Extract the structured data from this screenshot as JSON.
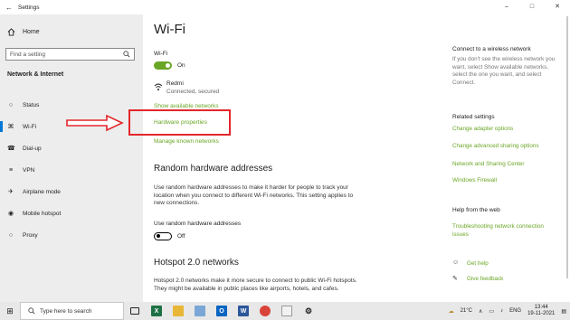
{
  "window": {
    "title": "Settings",
    "back_glyph": "←",
    "controls": [
      "–",
      "□",
      "✕"
    ]
  },
  "sidebar": {
    "home": "Home",
    "search_placeholder": "Find a setting",
    "section": "Network & Internet",
    "items": [
      {
        "label": "Status",
        "icon": "globe-icon"
      },
      {
        "label": "Wi-Fi",
        "icon": "wifi-icon"
      },
      {
        "label": "Dial-up",
        "icon": "phone-icon"
      },
      {
        "label": "VPN",
        "icon": "vpn-icon"
      },
      {
        "label": "Airplane mode",
        "icon": "airplane-icon"
      },
      {
        "label": "Mobile hotspot",
        "icon": "hotspot-icon"
      },
      {
        "label": "Proxy",
        "icon": "globe-icon"
      }
    ]
  },
  "main": {
    "title": "Wi-Fi",
    "wifi_label": "Wi-Fi",
    "wifi_state": "On",
    "network_name": "Redmi",
    "network_status": "Connected, secured",
    "show_networks": "Show available networks",
    "hardware_properties": "Hardware properties",
    "manage_networks": "Manage known networks",
    "random_title": "Random hardware addresses",
    "random_desc": "Use random hardware addresses to make it harder for people to track your location when you connect to different Wi-Fi networks. This setting applies to new connections.",
    "random_label": "Use random hardware addresses",
    "random_state": "Off",
    "hotspot_title": "Hotspot 2.0 networks",
    "hotspot_desc": "Hotspot 2.0 networks make it more secure to connect to public Wi-Fi hotspots. They might be available in public places like airports, hotels, and cafes."
  },
  "right_panel": {
    "connect_title": "Connect to a wireless network",
    "connect_desc": "If you don't see the wireless network you want, select Show available networks, select the one you want, and select Connect.",
    "related_title": "Related settings",
    "related_links": [
      "Change adapter options",
      "Change advanced sharing options",
      "Network and Sharing Center",
      "Windows Firewall"
    ],
    "help_title": "Help from the web",
    "help_link": "Troubleshooting network connection issues",
    "get_help": "Get help",
    "give_feedback": "Give feedback"
  },
  "taskbar": {
    "search_placeholder": "Type here to search",
    "temperature": "21°C",
    "language": "ENG",
    "time": "13:44",
    "date": "19-11-2021"
  },
  "colors": {
    "accent_green": "#6aa625",
    "highlight_red": "#e3262b",
    "active_blue": "#0078d7"
  }
}
